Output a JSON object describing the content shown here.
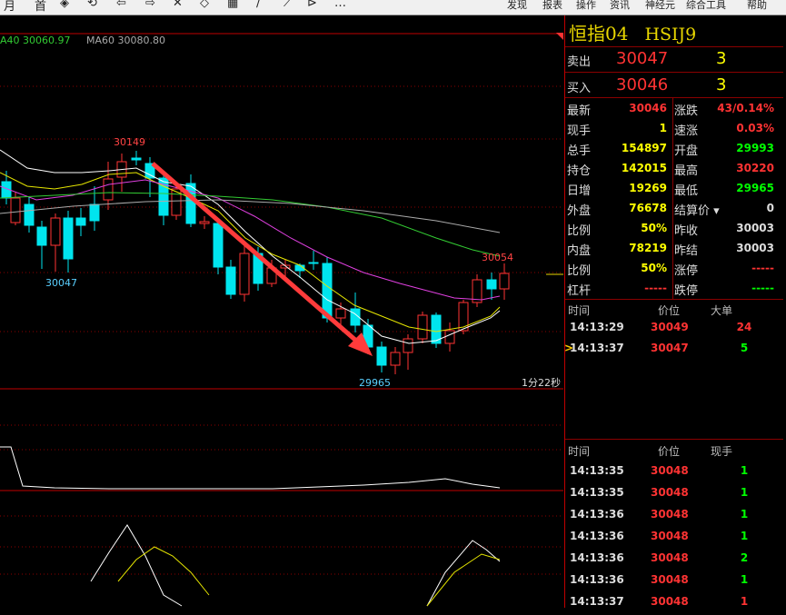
{
  "toolbar": {
    "icons": [
      "grid-icon",
      "list-icon",
      "zoom-icon",
      "back-icon",
      "forward-icon",
      "cross-icon",
      "diamond-icon",
      "save-icon",
      "pen-icon",
      "line-icon",
      "play-icon",
      "more-icon"
    ],
    "glyphs": [
      "月",
      "首",
      "◈",
      "⟲",
      "⇦",
      "⇨",
      "✕",
      "◇",
      "▦",
      "∕",
      "⟋",
      "⊳",
      "…"
    ],
    "menus": [
      "发现",
      "报表",
      "操作",
      "资讯",
      "神经元",
      "综合工具",
      "帮助"
    ]
  },
  "chart": {
    "ma40": "A40 30060.97",
    "ma60": "MA60 30080.80",
    "label_high": "30149",
    "label_low_left": "30047",
    "label_low": "29965",
    "label_right": "30054",
    "timer": "1分22秒",
    "colors": {
      "up": "#ff3333",
      "down": "#00e5ee",
      "ma5": "#ffffff",
      "ma10": "#e6e600",
      "ma20": "#e040e0",
      "ma40": "#33cc33",
      "ma60": "#aaaaaa",
      "arrow": "#ff3b3b",
      "grid": "#8b0000"
    }
  },
  "panel": {
    "title": "恒指04",
    "code": "HSIJ9",
    "sell": {
      "label": "卖出",
      "price": "30047",
      "vol": "3"
    },
    "buy": {
      "label": "买入",
      "price": "30046",
      "vol": "3"
    },
    "stats_left": [
      {
        "label": "最新",
        "value": "30046",
        "color": "#ff3333"
      },
      {
        "label": "现手",
        "value": "1",
        "color": "#ffff00"
      },
      {
        "label": "总手",
        "value": "154897",
        "color": "#ffff00"
      },
      {
        "label": "持仓",
        "value": "142015",
        "color": "#ffff00"
      },
      {
        "label": "日增",
        "value": "19269",
        "color": "#ffff00"
      },
      {
        "label": "外盘",
        "value": "76678",
        "color": "#ffff00"
      },
      {
        "label": "比例",
        "value": "50%",
        "color": "#ffff00"
      },
      {
        "label": "内盘",
        "value": "78219",
        "color": "#ffff00"
      },
      {
        "label": "比例",
        "value": "50%",
        "color": "#ffff00"
      },
      {
        "label": "杠杆",
        "value": "-----",
        "color": "#ff3333"
      }
    ],
    "stats_right": [
      {
        "label": "涨跌",
        "value": "43/0.14%",
        "color": "#ff3333"
      },
      {
        "label": "速涨",
        "value": "0.03%",
        "color": "#ff3333"
      },
      {
        "label": "开盘",
        "value": "29993",
        "color": "#00ff00"
      },
      {
        "label": "最高",
        "value": "30220",
        "color": "#ff3333"
      },
      {
        "label": "最低",
        "value": "29965",
        "color": "#00ff00"
      },
      {
        "label": "结算价",
        "value": "0",
        "color": "#dddddd"
      },
      {
        "label": "昨收",
        "value": "30003",
        "color": "#dddddd"
      },
      {
        "label": "昨结",
        "value": "30003",
        "color": "#dddddd"
      },
      {
        "label": "涨停",
        "value": "-----",
        "color": "#ff3333"
      },
      {
        "label": "跌停",
        "value": "-----",
        "color": "#00ff00"
      }
    ],
    "big_orders": {
      "headers": [
        "时间",
        "价位",
        "大单"
      ],
      "rows": [
        {
          "time": "14:13:29",
          "price": "30049",
          "vol": "24",
          "vcolor": "#ff3333"
        },
        {
          "time": "14:13:37",
          "price": "30047",
          "vol": "5",
          "vcolor": "#00ff00"
        }
      ]
    },
    "ticks": {
      "headers": [
        "时间",
        "价位",
        "现手"
      ],
      "rows": [
        {
          "time": "14:13:35",
          "price": "30048",
          "vol": "1",
          "vcolor": "#00ff00"
        },
        {
          "time": "14:13:35",
          "price": "30048",
          "vol": "1",
          "vcolor": "#00ff00"
        },
        {
          "time": "14:13:36",
          "price": "30048",
          "vol": "1",
          "vcolor": "#00ff00"
        },
        {
          "time": "14:13:36",
          "price": "30048",
          "vol": "1",
          "vcolor": "#00ff00"
        },
        {
          "time": "14:13:36",
          "price": "30048",
          "vol": "2",
          "vcolor": "#00ff00"
        },
        {
          "time": "14:13:36",
          "price": "30048",
          "vol": "1",
          "vcolor": "#00ff00"
        },
        {
          "time": "14:13:37",
          "price": "30048",
          "vol": "1",
          "vcolor": "#ff3333"
        }
      ]
    }
  }
}
